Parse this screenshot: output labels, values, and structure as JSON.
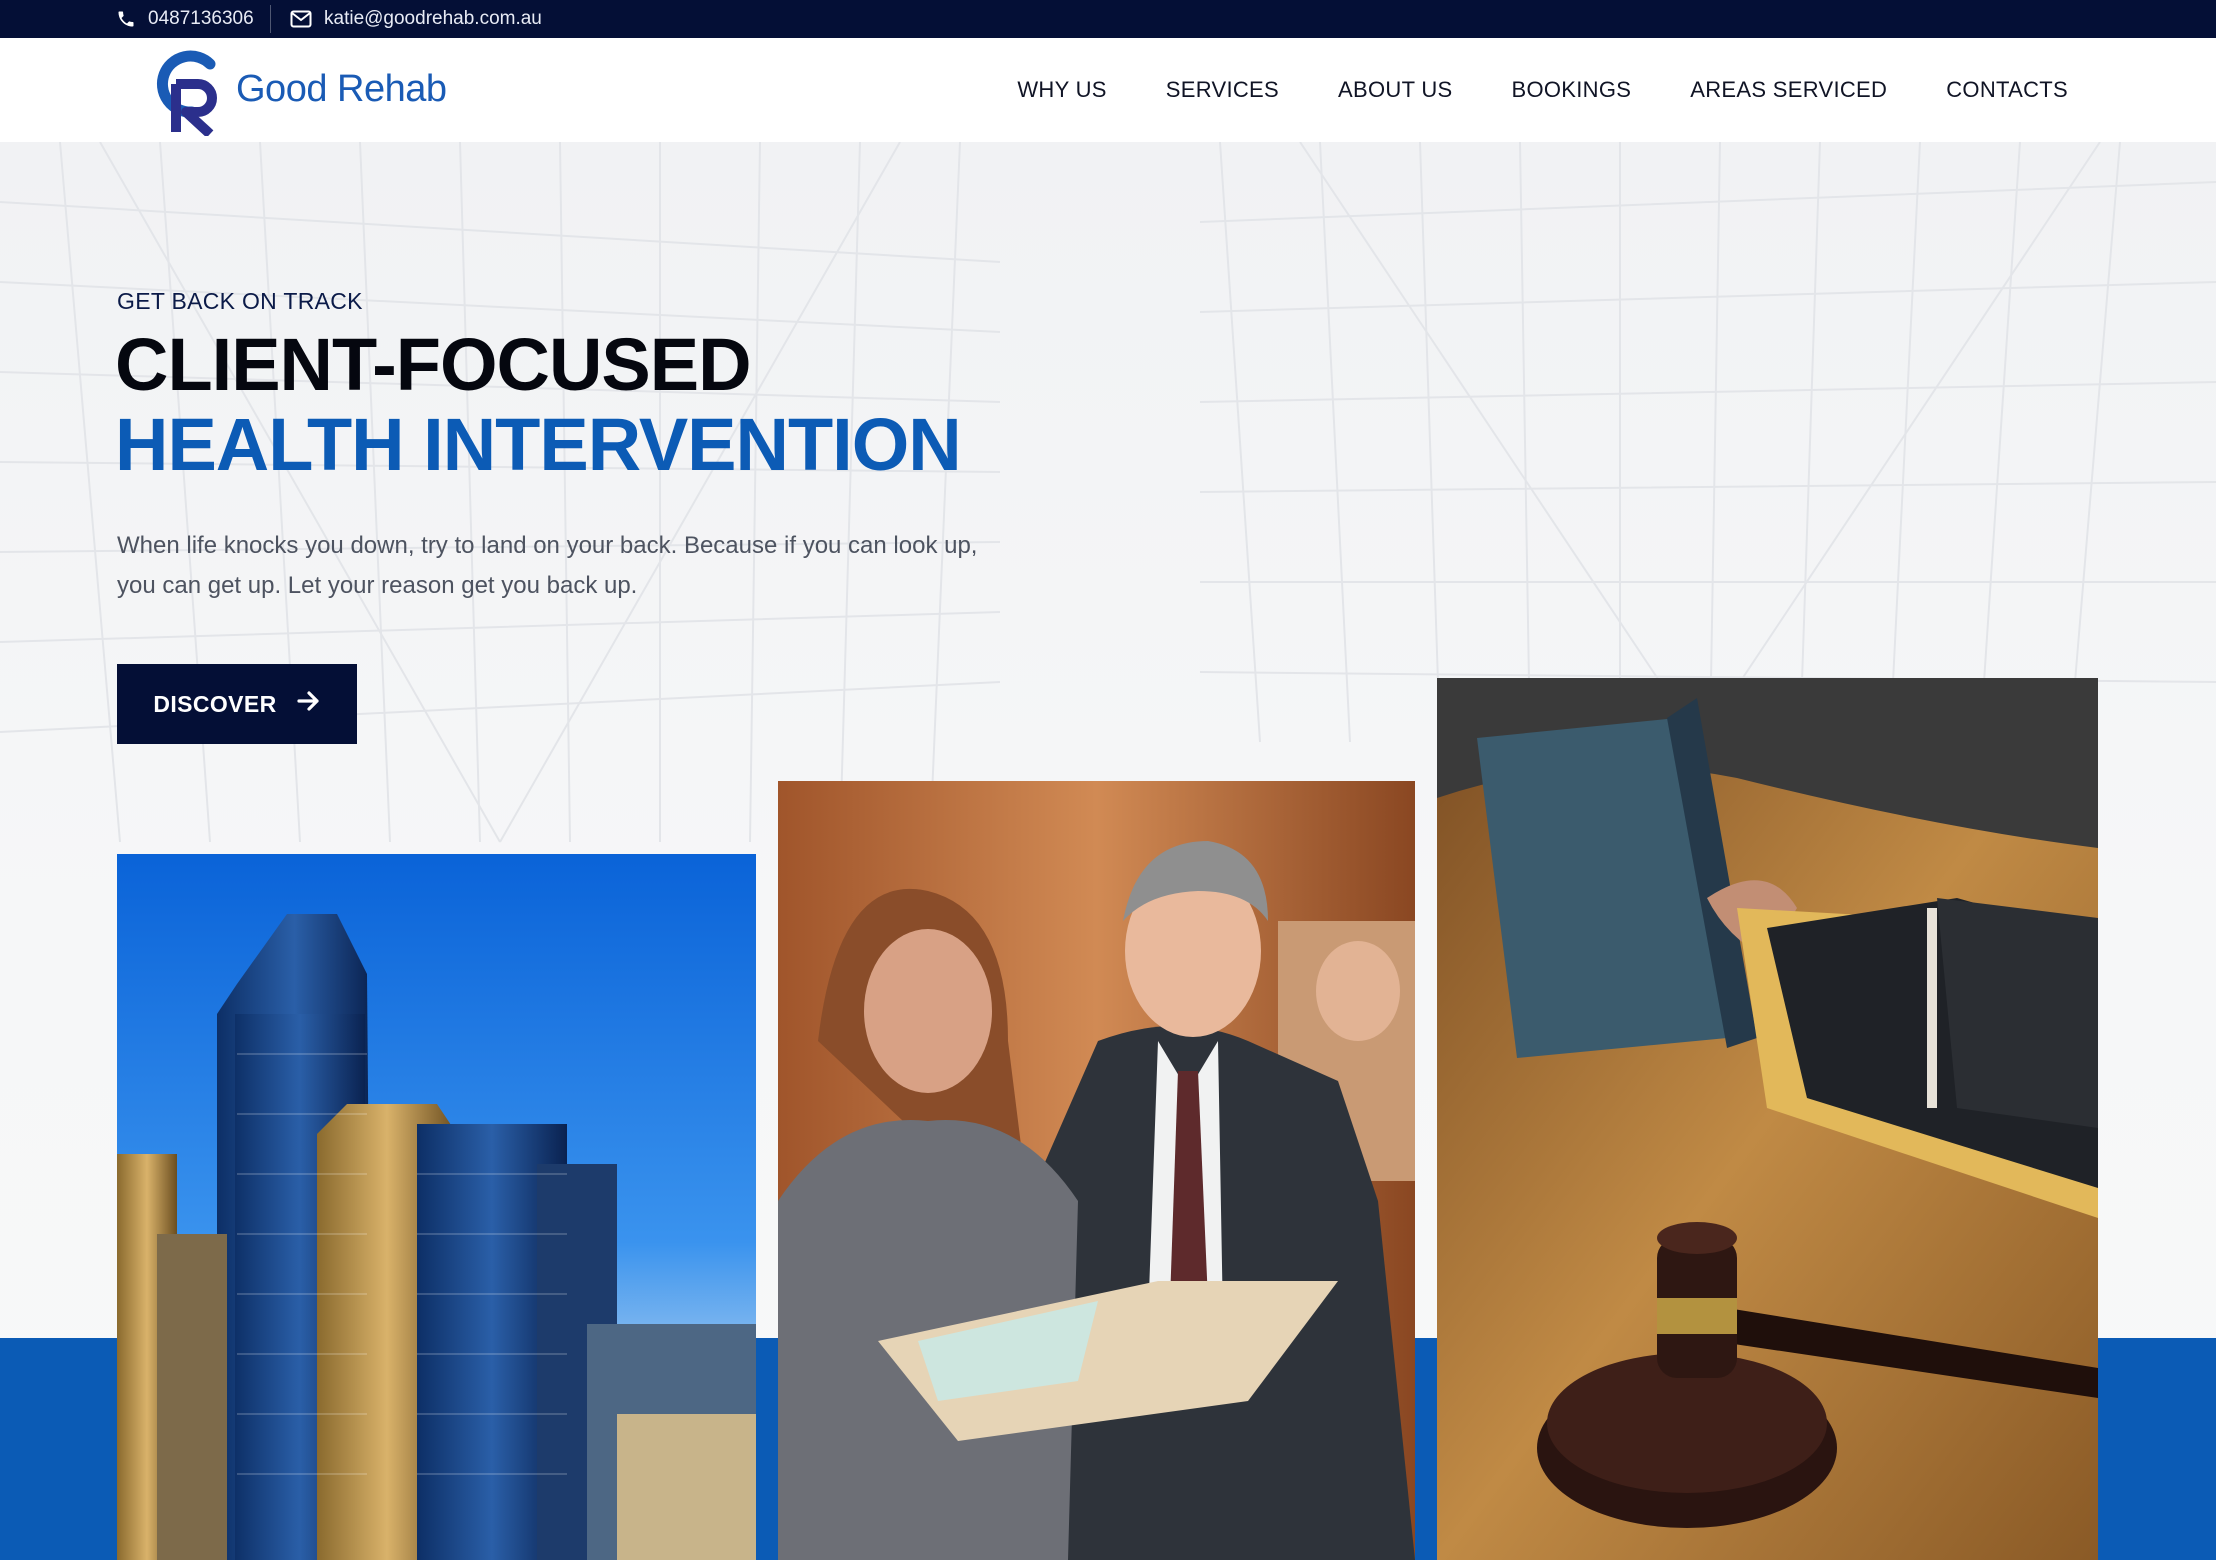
{
  "topbar": {
    "phone": "0487136306",
    "email": "katie@goodrehab.com.au",
    "phone_icon": "phone-icon",
    "email_icon": "envelope-icon"
  },
  "brand": {
    "name": "Good Rehab",
    "logo_icon": "gr-monogram-logo"
  },
  "nav": {
    "items": [
      {
        "label": "WHY US"
      },
      {
        "label": "SERVICES"
      },
      {
        "label": "ABOUT US"
      },
      {
        "label": "BOOKINGS"
      },
      {
        "label": "AREAS SERVICED"
      },
      {
        "label": "CONTACTS"
      }
    ]
  },
  "hero": {
    "kicker": "GET BACK ON TRACK",
    "title_line1": "CLIENT-FOCUSED",
    "title_line2": "HEALTH INTERVENTION",
    "lead": "When life knocks you down, try to land on your back. Because if you can look up, you can get up. Let your reason get you back up.",
    "cta_label": "DISCOVER",
    "cta_icon": "arrow-right-icon"
  },
  "colors": {
    "navy": "#040f36",
    "brand_blue": "#0c5bb5",
    "text_dark": "#05070f",
    "body_gray": "#4d5360"
  }
}
